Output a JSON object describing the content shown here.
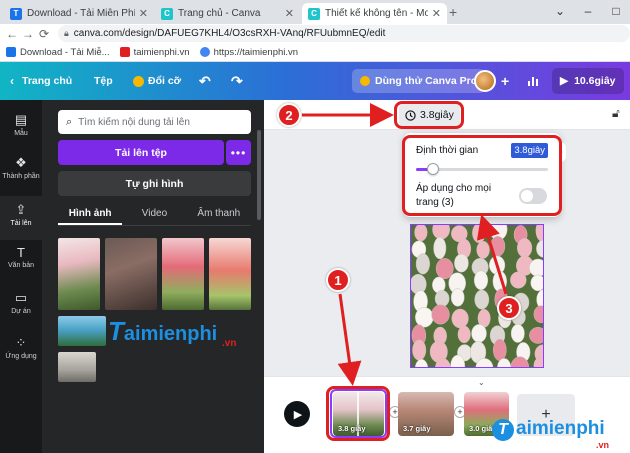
{
  "browser": {
    "tabs": [
      {
        "title": "Download - Tải Miễn Phí VN - Ph",
        "favicon_color": "#1a73e8"
      },
      {
        "title": "Trang chủ - Canva",
        "favicon_color": "#20c4cb"
      },
      {
        "title": "Thiết kế không tên - Mobile Video",
        "favicon_color": "#20c4cb"
      }
    ],
    "url": "canva.com/design/DAFUEG7KHL4/O3csRXH-VAnq/RFUubmnEQ/edit",
    "bookmarks": [
      {
        "label": "Download - Tải Miễ...",
        "color": "#1a73e8"
      },
      {
        "label": "taimienphi.vn",
        "color": "#e02020"
      },
      {
        "label": "https://taimienphi.vn",
        "color": "#4285f4"
      }
    ]
  },
  "header": {
    "home": "Trang chủ",
    "file": "Tệp",
    "resize": "Đổi cỡ",
    "try_pro": "Dùng thử Canva Pro",
    "duration": "10.6giây"
  },
  "rail": [
    {
      "label": "Mẫu",
      "icon": "template-icon"
    },
    {
      "label": "Thành phần",
      "icon": "elements-icon"
    },
    {
      "label": "Tải lên",
      "icon": "upload-icon"
    },
    {
      "label": "Văn bản",
      "icon": "text-icon"
    },
    {
      "label": "Dự án",
      "icon": "folder-icon"
    },
    {
      "label": "Ứng dụng",
      "icon": "apps-icon"
    }
  ],
  "panel": {
    "search_placeholder": "Tìm kiếm nội dung tải lên",
    "upload": "Tải lên tệp",
    "more": "•••",
    "record": "Tự ghi hình",
    "tabs": [
      "Hình ảnh",
      "Video",
      "Âm thanh"
    ]
  },
  "canvas": {
    "duration": "3.8giây",
    "popup": {
      "label": "Định thời gian",
      "value": "3.8giây",
      "slider_level": 0.13,
      "apply_all": "Áp dụng cho mọi trang (3)",
      "apply_all_on": false
    }
  },
  "timeline": {
    "clips": [
      {
        "label": "3.8 giây",
        "selected": true
      },
      {
        "label": "3.7 giây",
        "selected": false
      },
      {
        "label": "3.0 giây",
        "selected": false
      }
    ],
    "add": "+"
  },
  "watermark": {
    "brand_main": "aimienphi",
    "brand_suffix": ".vn",
    "brand_t": "T"
  },
  "annotations": [
    "1",
    "2",
    "3"
  ]
}
